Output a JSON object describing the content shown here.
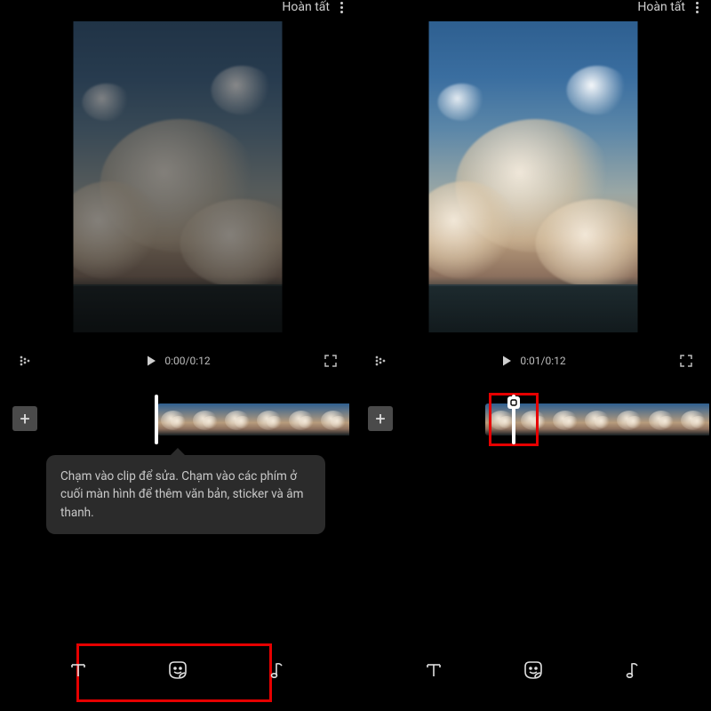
{
  "left": {
    "header": {
      "done": "Hoàn tất"
    },
    "playbar": {
      "time": "0:00/0:12"
    },
    "tooltip": "Chạm vào clip để sửa. Chạm vào các phím ở cuối màn hình để thêm văn bản, sticker và âm thanh."
  },
  "right": {
    "header": {
      "done": "Hoàn tất"
    },
    "playbar": {
      "time": "0:01/0:12"
    }
  },
  "icons": {
    "text": "T",
    "sticker": "sticker",
    "music": "music"
  }
}
